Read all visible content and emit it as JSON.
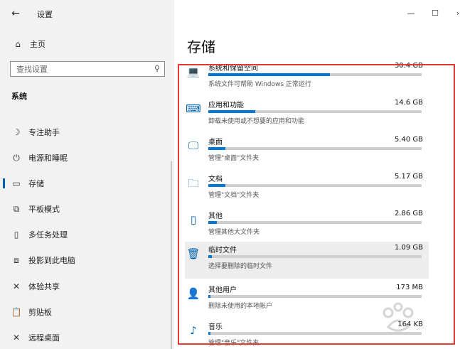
{
  "window": {
    "title": "设置",
    "controls": [
      "—",
      "☐",
      "›"
    ]
  },
  "sidebar": {
    "back_icon": "←",
    "home": {
      "icon": "⌂",
      "label": "主页"
    },
    "search": {
      "placeholder": "查找设置",
      "icon": "⚲"
    },
    "section": "系统",
    "items": [
      {
        "icon": "☽",
        "label": "专注助手"
      },
      {
        "icon": "⏻",
        "label": "电源和睡眠"
      },
      {
        "icon": "▭",
        "label": "存储"
      },
      {
        "icon": "⧉",
        "label": "平板模式"
      },
      {
        "icon": "▯",
        "label": "多任务处理"
      },
      {
        "icon": "⧈",
        "label": "投影到此电脑"
      },
      {
        "icon": "✕",
        "label": "体验共享"
      },
      {
        "icon": "📋",
        "label": "剪贴板"
      },
      {
        "icon": "✕",
        "label": "远程桌面"
      }
    ],
    "active_index": 2
  },
  "main": {
    "title": "存储",
    "rows": [
      {
        "icon": "💻",
        "name": "系统和保留空间",
        "size": "30.4 GB",
        "desc": "系统文件可帮助 Windows 正常运行",
        "fill": 0.57
      },
      {
        "icon": "⌨",
        "name": "应用和功能",
        "size": "14.6 GB",
        "desc": "卸载未使用或不想要的应用和功能",
        "fill": 0.22
      },
      {
        "icon": "🖵",
        "name": "桌面",
        "size": "5.40 GB",
        "desc": "管理\"桌面\"文件夹",
        "fill": 0.08
      },
      {
        "icon": "🗀",
        "name": "文档",
        "size": "5.17 GB",
        "desc": "管理\"文档\"文件夹",
        "fill": 0.08
      },
      {
        "icon": "▯",
        "name": "其他",
        "size": "2.86 GB",
        "desc": "管理其他大文件夹",
        "fill": 0.04
      },
      {
        "icon": "🗑",
        "name": "临时文件",
        "size": "1.09 GB",
        "desc": "选择要删除的临时文件",
        "fill": 0.015
      },
      {
        "icon": "👤",
        "name": "其他用户",
        "size": "173 MB",
        "desc": "删除未使用的本地帐户",
        "fill": 0.005
      },
      {
        "icon": "♪",
        "name": "音乐",
        "size": "164 KB",
        "desc": "管理\"音乐\"文件夹",
        "fill": 0.002
      }
    ]
  },
  "colors": {
    "accent": "#0078d7",
    "highlight_border": "#e53935",
    "sidebar_bg": "#f2f2f2"
  }
}
